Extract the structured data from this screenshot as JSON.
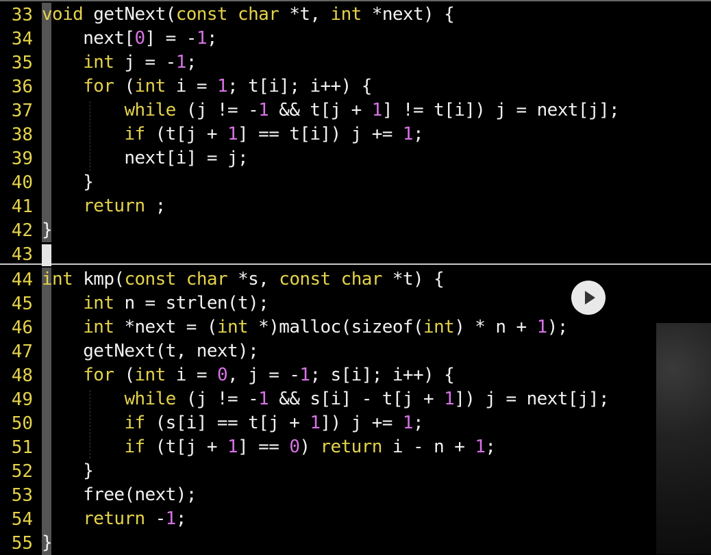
{
  "lines": [
    {
      "n": "33",
      "t": [
        [
          "void",
          "tk-type"
        ],
        [
          " getNext(",
          "tk-plain"
        ],
        [
          "const",
          "tk-keyword"
        ],
        [
          " ",
          "tk-plain"
        ],
        [
          "char",
          "tk-type"
        ],
        [
          " *t, ",
          "tk-plain"
        ],
        [
          "int",
          "tk-type"
        ],
        [
          " *next) {",
          "tk-plain"
        ]
      ]
    },
    {
      "n": "34",
      "t": [
        [
          "    next[",
          "tk-plain"
        ],
        [
          "0",
          "tk-number"
        ],
        [
          "] = -",
          "tk-plain"
        ],
        [
          "1",
          "tk-number"
        ],
        [
          ";",
          "tk-plain"
        ]
      ]
    },
    {
      "n": "35",
      "t": [
        [
          "    ",
          "tk-plain"
        ],
        [
          "int",
          "tk-type"
        ],
        [
          " j = -",
          "tk-plain"
        ],
        [
          "1",
          "tk-number"
        ],
        [
          ";",
          "tk-plain"
        ]
      ]
    },
    {
      "n": "36",
      "t": [
        [
          "    ",
          "tk-plain"
        ],
        [
          "for",
          "tk-keyword"
        ],
        [
          " (",
          "tk-plain"
        ],
        [
          "int",
          "tk-type"
        ],
        [
          " i = ",
          "tk-plain"
        ],
        [
          "1",
          "tk-number"
        ],
        [
          "; t[i]; i++) {",
          "tk-plain"
        ]
      ]
    },
    {
      "n": "37",
      "t": [
        [
          "        ",
          "tk-plain"
        ],
        [
          "while",
          "tk-keyword"
        ],
        [
          " (j != -",
          "tk-plain"
        ],
        [
          "1",
          "tk-number"
        ],
        [
          " && t[j + ",
          "tk-plain"
        ],
        [
          "1",
          "tk-number"
        ],
        [
          "] != t[i]) j = next[j];",
          "tk-plain"
        ]
      ]
    },
    {
      "n": "38",
      "t": [
        [
          "        ",
          "tk-plain"
        ],
        [
          "if",
          "tk-keyword"
        ],
        [
          " (t[j + ",
          "tk-plain"
        ],
        [
          "1",
          "tk-number"
        ],
        [
          "] == t[i]) j += ",
          "tk-plain"
        ],
        [
          "1",
          "tk-number"
        ],
        [
          ";",
          "tk-plain"
        ]
      ]
    },
    {
      "n": "39",
      "t": [
        [
          "        next[i] = j;",
          "tk-plain"
        ]
      ]
    },
    {
      "n": "40",
      "t": [
        [
          "    }",
          "tk-plain"
        ]
      ]
    },
    {
      "n": "41",
      "t": [
        [
          "    ",
          "tk-plain"
        ],
        [
          "return",
          "tk-keyword"
        ],
        [
          " ;",
          "tk-plain"
        ]
      ]
    },
    {
      "n": "42",
      "t": [
        [
          "}",
          "tk-plain"
        ]
      ]
    },
    {
      "n": "43",
      "t": []
    },
    {
      "n": "44",
      "t": [
        [
          "int",
          "tk-type"
        ],
        [
          " kmp(",
          "tk-plain"
        ],
        [
          "const",
          "tk-keyword"
        ],
        [
          " ",
          "tk-plain"
        ],
        [
          "char",
          "tk-type"
        ],
        [
          " *s, ",
          "tk-plain"
        ],
        [
          "const",
          "tk-keyword"
        ],
        [
          " ",
          "tk-plain"
        ],
        [
          "char",
          "tk-type"
        ],
        [
          " *t) {",
          "tk-plain"
        ]
      ]
    },
    {
      "n": "45",
      "t": [
        [
          "    ",
          "tk-plain"
        ],
        [
          "int",
          "tk-type"
        ],
        [
          " n = strlen(t);",
          "tk-plain"
        ]
      ]
    },
    {
      "n": "46",
      "t": [
        [
          "    ",
          "tk-plain"
        ],
        [
          "int",
          "tk-type"
        ],
        [
          " *next = (",
          "tk-plain"
        ],
        [
          "int",
          "tk-type"
        ],
        [
          " *)malloc(sizeof(",
          "tk-plain"
        ],
        [
          "int",
          "tk-type"
        ],
        [
          ") * n + ",
          "tk-plain"
        ],
        [
          "1",
          "tk-number"
        ],
        [
          ");",
          "tk-plain"
        ]
      ]
    },
    {
      "n": "47",
      "t": [
        [
          "    getNext(t, next);",
          "tk-plain"
        ]
      ]
    },
    {
      "n": "48",
      "t": [
        [
          "    ",
          "tk-plain"
        ],
        [
          "for",
          "tk-keyword"
        ],
        [
          " (",
          "tk-plain"
        ],
        [
          "int",
          "tk-type"
        ],
        [
          " i = ",
          "tk-plain"
        ],
        [
          "0",
          "tk-number"
        ],
        [
          ", j = -",
          "tk-plain"
        ],
        [
          "1",
          "tk-number"
        ],
        [
          "; s[i]; i++) {",
          "tk-plain"
        ]
      ]
    },
    {
      "n": "49",
      "t": [
        [
          "        ",
          "tk-plain"
        ],
        [
          "while",
          "tk-keyword"
        ],
        [
          " (j != -",
          "tk-plain"
        ],
        [
          "1",
          "tk-number"
        ],
        [
          " && s[i] - t[j + ",
          "tk-plain"
        ],
        [
          "1",
          "tk-number"
        ],
        [
          "]) j = next[j];",
          "tk-plain"
        ]
      ]
    },
    {
      "n": "50",
      "t": [
        [
          "        ",
          "tk-plain"
        ],
        [
          "if",
          "tk-keyword"
        ],
        [
          " (s[i] == t[j + ",
          "tk-plain"
        ],
        [
          "1",
          "tk-number"
        ],
        [
          "]) j += ",
          "tk-plain"
        ],
        [
          "1",
          "tk-number"
        ],
        [
          ";",
          "tk-plain"
        ]
      ]
    },
    {
      "n": "51",
      "t": [
        [
          "        ",
          "tk-plain"
        ],
        [
          "if",
          "tk-keyword"
        ],
        [
          " (t[j + ",
          "tk-plain"
        ],
        [
          "1",
          "tk-number"
        ],
        [
          "] == ",
          "tk-plain"
        ],
        [
          "0",
          "tk-number"
        ],
        [
          ") ",
          "tk-plain"
        ],
        [
          "return",
          "tk-keyword"
        ],
        [
          " i - n + ",
          "tk-plain"
        ],
        [
          "1",
          "tk-number"
        ],
        [
          ";",
          "tk-plain"
        ]
      ]
    },
    {
      "n": "52",
      "t": [
        [
          "    }",
          "tk-plain"
        ]
      ]
    },
    {
      "n": "53",
      "t": [
        [
          "    free(next);",
          "tk-plain"
        ]
      ]
    },
    {
      "n": "54",
      "t": [
        [
          "    ",
          "tk-plain"
        ],
        [
          "return",
          "tk-keyword"
        ],
        [
          " -",
          "tk-plain"
        ],
        [
          "1",
          "tk-number"
        ],
        [
          ";",
          "tk-plain"
        ]
      ]
    },
    {
      "n": "55",
      "t": [
        [
          "}",
          "tk-plain"
        ]
      ]
    }
  ],
  "colors": {
    "keyword": "#e5d34a",
    "number": "#d873e6",
    "text": "#f2f2f2",
    "line_number": "#e5d34a",
    "background": "#000000"
  },
  "icons": {
    "play": "play-icon"
  }
}
